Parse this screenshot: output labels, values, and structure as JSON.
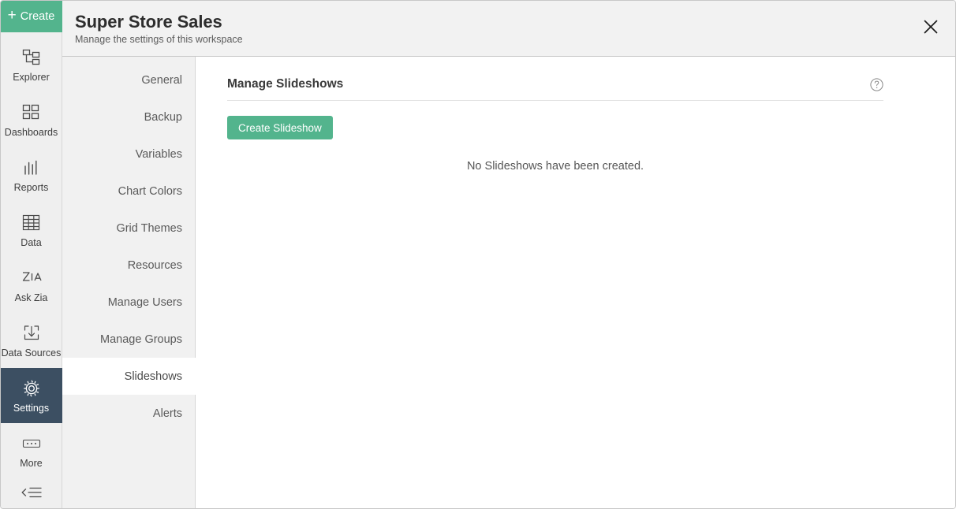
{
  "rail": {
    "create_label": "Create",
    "create_icon": "plus-icon",
    "items": [
      {
        "label": "Explorer",
        "icon": "hierarchy-icon",
        "active": false
      },
      {
        "label": "Dashboards",
        "icon": "dashboard-grid-icon",
        "active": false
      },
      {
        "label": "Reports",
        "icon": "bar-chart-icon",
        "active": false
      },
      {
        "label": "Data",
        "icon": "table-icon",
        "active": false
      },
      {
        "label": "Ask Zia",
        "icon": "zia-icon",
        "active": false
      },
      {
        "label": "Data Sources",
        "icon": "data-import-icon",
        "active": false
      },
      {
        "label": "Settings",
        "icon": "gear-icon",
        "active": true
      },
      {
        "label": "More",
        "icon": "ellipsis-box-icon",
        "active": false
      }
    ],
    "collapse_icon": "collapse-left-icon"
  },
  "header": {
    "title": "Super Store Sales",
    "subtitle": "Manage the settings of this workspace",
    "close_icon": "close-icon"
  },
  "settings_nav": {
    "items": [
      {
        "label": "General",
        "active": false
      },
      {
        "label": "Backup",
        "active": false
      },
      {
        "label": "Variables",
        "active": false
      },
      {
        "label": "Chart Colors",
        "active": false
      },
      {
        "label": "Grid Themes",
        "active": false
      },
      {
        "label": "Resources",
        "active": false
      },
      {
        "label": "Manage Users",
        "active": false
      },
      {
        "label": "Manage Groups",
        "active": false
      },
      {
        "label": "Slideshows",
        "active": true
      },
      {
        "label": "Alerts",
        "active": false
      }
    ]
  },
  "content": {
    "title": "Manage Slideshows",
    "help_icon": "help-circle-icon",
    "create_slideshow_label": "Create Slideshow",
    "empty_message": "No Slideshows have been created."
  },
  "colors": {
    "accent_green": "#53b48d",
    "active_rail": "#3c4f62",
    "rail_bg": "#efefef",
    "header_bg": "#f2f2f2",
    "nav_bg": "#f1f1f1"
  }
}
